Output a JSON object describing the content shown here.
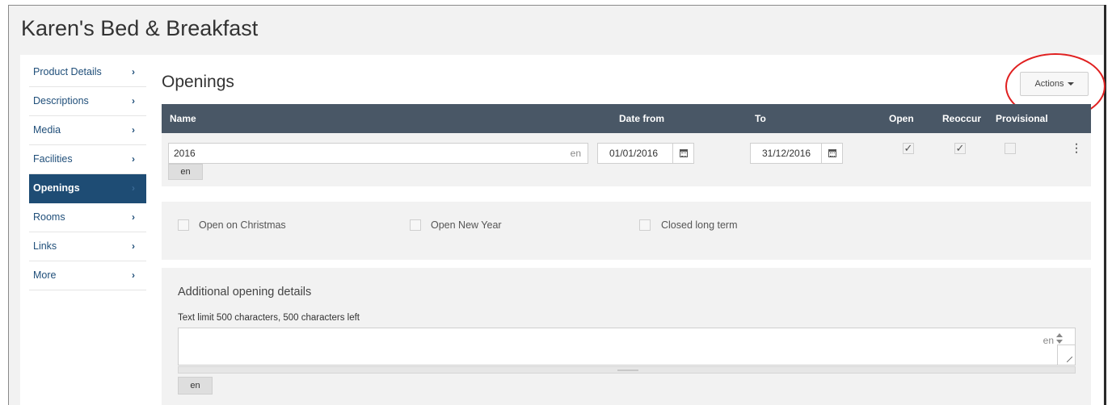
{
  "app": {
    "title": "Karen's Bed & Breakfast"
  },
  "sidebar": {
    "items": [
      {
        "label": "Product Details",
        "active": false
      },
      {
        "label": "Descriptions",
        "active": false
      },
      {
        "label": "Media",
        "active": false
      },
      {
        "label": "Facilities",
        "active": false
      },
      {
        "label": "Openings",
        "active": true
      },
      {
        "label": "Rooms",
        "active": false
      },
      {
        "label": "Links",
        "active": false
      },
      {
        "label": "More",
        "active": false
      }
    ],
    "chevron": "›"
  },
  "section": {
    "title": "Openings"
  },
  "actions": {
    "label": "Actions"
  },
  "table": {
    "headers": {
      "name": "Name",
      "date_from": "Date from",
      "to": "To",
      "open": "Open",
      "reoccur": "Reoccur",
      "provisional": "Provisional"
    },
    "rows": [
      {
        "name": "2016",
        "name_lang": "en",
        "lang_tab": "en",
        "date_from": "01/01/2016",
        "date_to": "31/12/2016",
        "open": true,
        "reoccur": true,
        "provisional": false
      }
    ]
  },
  "options": {
    "christmas": {
      "label": "Open on Christmas",
      "checked": false
    },
    "new_year": {
      "label": "Open New Year",
      "checked": false
    },
    "closed_long_term": {
      "label": "Closed long term",
      "checked": false
    }
  },
  "details": {
    "title": "Additional opening details",
    "limit_text": "Text limit 500 characters, 500 characters left",
    "value": "",
    "lang": "en",
    "lang_tab": "en"
  },
  "colors": {
    "accent": "#1e4c74",
    "table_header": "#495766",
    "highlight": "#e02020"
  },
  "icons": [
    "chevron-right-icon",
    "calendar-icon",
    "checkmark-icon",
    "kebab-menu-icon",
    "caret-down-icon",
    "spinner-icon",
    "resize-handle-icon"
  ]
}
